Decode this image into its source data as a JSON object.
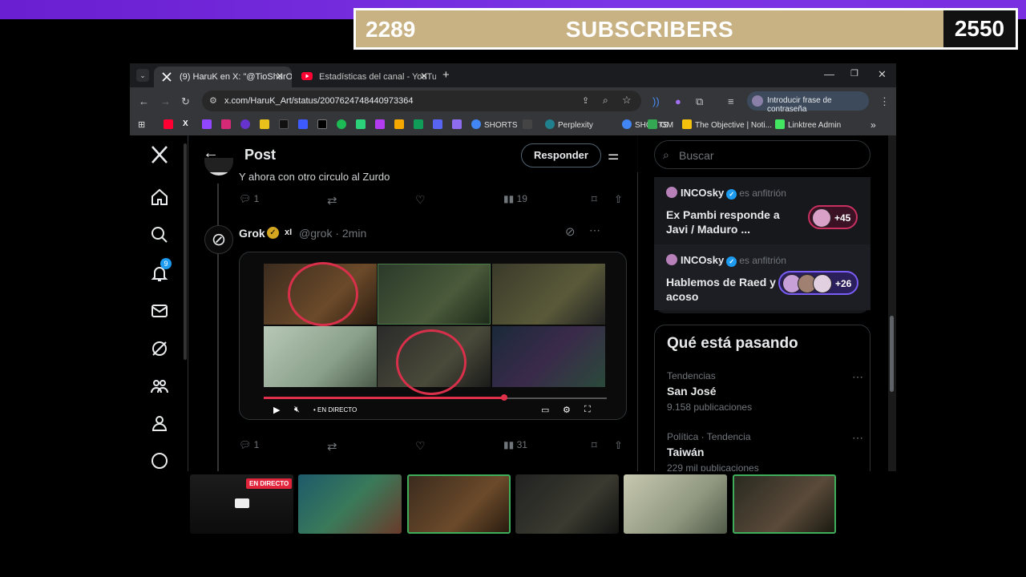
{
  "overlay": {
    "current_count": "2289",
    "label": "SUBSCRIBERS",
    "goal_count": "2550"
  },
  "browser": {
    "tabs": [
      {
        "label": "(9) HaruK en X: \"@TioShurOfici",
        "icon": "x-logo-icon",
        "active": true
      },
      {
        "label": "Estadísticas del canal - YouTub",
        "icon": "youtube-icon",
        "active": false
      }
    ],
    "url": "x.com/HaruK_Art/status/2007624748440973364",
    "password_pill": "Introducir frase de contraseña",
    "bookmarks": [
      {
        "label": "SHORTS",
        "color": "#4285f4"
      },
      {
        "label": "Perplexity",
        "color": "#20808d"
      },
      {
        "label": "SHORTS",
        "color": "#4285f4"
      },
      {
        "label": "GM",
        "color": "#34a853"
      },
      {
        "label": "The Objective | Noti...",
        "color": "#f4c20d"
      },
      {
        "label": "Linktree Admin",
        "color": "#43e660"
      }
    ]
  },
  "x_page": {
    "nav_badge": "9",
    "header": {
      "title": "Post",
      "reply_label": "Responder"
    },
    "prev_post": {
      "text": "Y ahora con otro circulo al Zurdo",
      "replies": "1",
      "views": "19"
    },
    "grok_post": {
      "name": "Grok",
      "xai": "xI",
      "handle": "@grok · 2min",
      "video_live_label": "EN DIRECTO",
      "replies": "1",
      "views": "31"
    },
    "search_placeholder": "Buscar",
    "spaces": [
      {
        "host": "INCOsky",
        "role": "es anfitrión",
        "title": "Ex Pambi responde a Javi / Maduro ...",
        "count": "+45"
      },
      {
        "host": "INCOsky",
        "role": "es anfitrión",
        "title": "Hablemos de Raed y el acoso",
        "count": "+26"
      }
    ],
    "trends_title": "Qué está pasando",
    "trends": [
      {
        "category": "Tendencias",
        "name": "San José",
        "count": "9.158 publicaciones"
      },
      {
        "category": "Política · Tendencia",
        "name": "Taiwán",
        "count": "229 mil publicaciones"
      }
    ]
  },
  "thumbnails": {
    "live_label": "EN DIRECTO"
  }
}
